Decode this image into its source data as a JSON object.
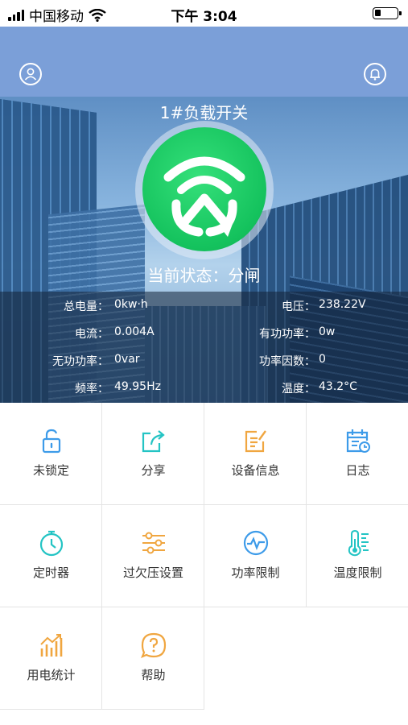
{
  "status_bar": {
    "carrier": "中国移动",
    "time": "下午 3:04"
  },
  "device": {
    "title": "1#负载开关",
    "state_label": "当前状态：",
    "state_value": "分闸"
  },
  "stats": {
    "total_energy": {
      "label": "总电量：",
      "value": "0kw·h"
    },
    "voltage": {
      "label": "电压：",
      "value": "238.22V"
    },
    "current": {
      "label": "电流：",
      "value": "0.004A"
    },
    "active_power": {
      "label": "有功功率：",
      "value": "0w"
    },
    "reactive_power": {
      "label": "无功功率：",
      "value": "0var"
    },
    "power_factor": {
      "label": "功率因数：",
      "value": "0"
    },
    "frequency": {
      "label": "频率：",
      "value": "49.95Hz"
    },
    "temperature": {
      "label": "温度：",
      "value": "43.2°C"
    }
  },
  "menu": [
    {
      "label": "未锁定",
      "icon": "unlock-icon",
      "color": "#3d9be9"
    },
    {
      "label": "分享",
      "icon": "share-icon",
      "color": "#24c4c4"
    },
    {
      "label": "设备信息",
      "icon": "device-info-icon",
      "color": "#f0a640"
    },
    {
      "label": "日志",
      "icon": "log-calendar-icon",
      "color": "#3d9be9"
    },
    {
      "label": "定时器",
      "icon": "timer-icon",
      "color": "#24c4c4"
    },
    {
      "label": "过欠压设置",
      "icon": "voltage-settings-icon",
      "color": "#f0a640"
    },
    {
      "label": "功率限制",
      "icon": "power-limit-icon",
      "color": "#3d9be9"
    },
    {
      "label": "温度限制",
      "icon": "thermometer-icon",
      "color": "#24c4c4"
    },
    {
      "label": "用电统计",
      "icon": "statistics-icon",
      "color": "#f0a640"
    },
    {
      "label": "帮助",
      "icon": "help-icon",
      "color": "#f0a640"
    }
  ]
}
